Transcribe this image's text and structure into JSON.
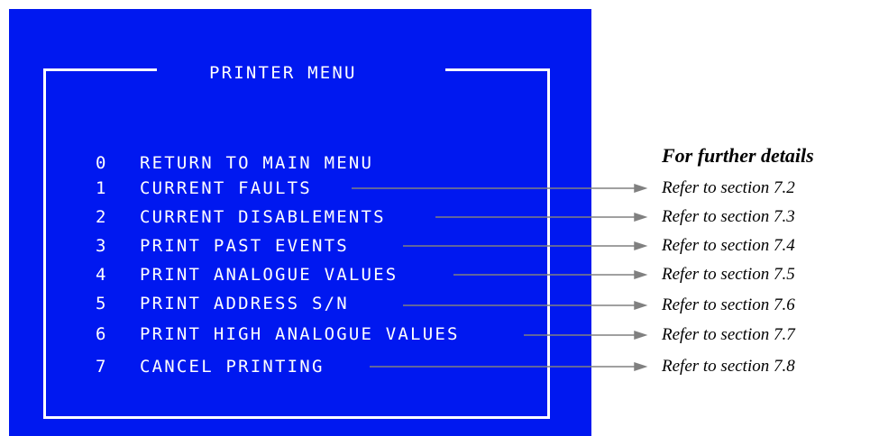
{
  "screen": {
    "title": "PRINTER MENU",
    "background": "#0018f0",
    "foreground": "#ffffff",
    "items": [
      {
        "number": "0",
        "label": "RETURN TO MAIN MENU"
      },
      {
        "number": "1",
        "label": "CURRENT FAULTS"
      },
      {
        "number": "2",
        "label": "CURRENT DISABLEMENTS"
      },
      {
        "number": "3",
        "label": "PRINT PAST EVENTS"
      },
      {
        "number": "4",
        "label": "PRINT ANALOGUE VALUES"
      },
      {
        "number": "5",
        "label": "PRINT ADDRESS S/N"
      },
      {
        "number": "6",
        "label": "PRINT HIGH ANALOGUE VALUES"
      },
      {
        "number": "7",
        "label": "CANCEL PRINTING"
      }
    ]
  },
  "annotations": {
    "heading": "For further details",
    "arrow_color": "#808080",
    "references": [
      "Refer to section 7.2",
      "Refer to section 7.3",
      "Refer to section 7.4",
      "Refer to section 7.5",
      "Refer to section 7.6",
      "Refer to section 7.7",
      "Refer to section 7.8"
    ]
  }
}
